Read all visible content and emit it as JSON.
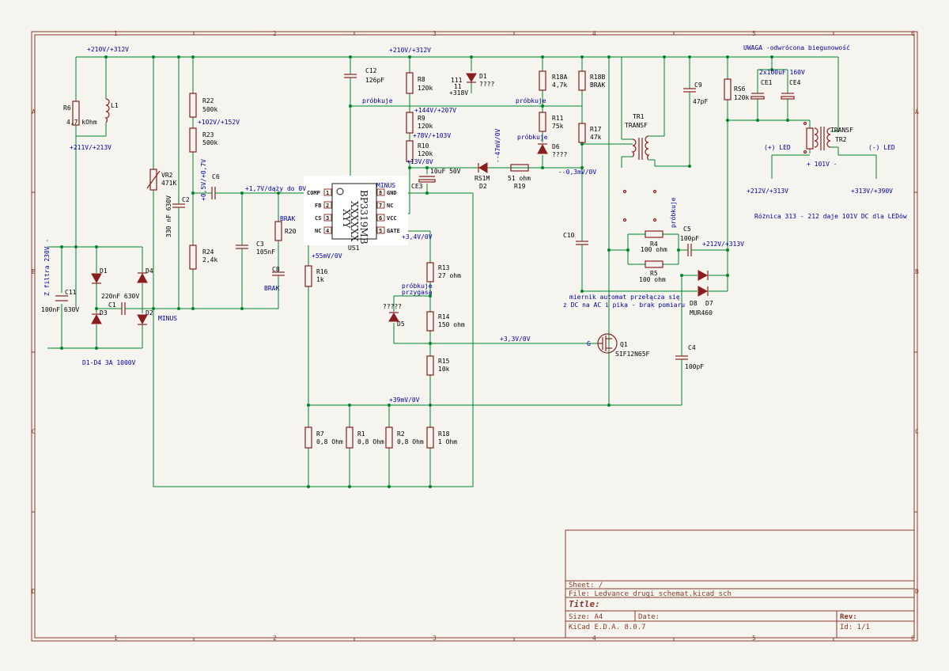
{
  "frame": {
    "cols": [
      "1",
      "2",
      "3",
      "4",
      "5",
      "6"
    ],
    "rows": [
      "A",
      "B",
      "C",
      "D"
    ]
  },
  "title_block": {
    "sheet": "Sheet: /",
    "file": "File: Ledvance drugi schemat.kicad_sch",
    "title": "Title:",
    "size": "Size: A4",
    "date": "Date:",
    "tool": "KiCad E.D.A. 8.0.7",
    "rev": "Rev:",
    "id": "Id: 1/1"
  },
  "ic": {
    "ref": "US1",
    "marking_1": "BP3319MB",
    "marking_2": "XXXXXX",
    "marking_3": "XYY",
    "minus": "MINUS",
    "pins_left": [
      "COMP",
      "FB",
      "CS",
      "NC"
    ],
    "pins_left_num": [
      "1",
      "2",
      "3",
      "4"
    ],
    "pins_right": [
      "GND",
      "NC",
      "VCC",
      "GATE"
    ],
    "pins_right_num": [
      "8",
      "7",
      "6",
      "5"
    ]
  },
  "components": {
    "R6": [
      "R6",
      "4,7 kOhm"
    ],
    "L1": [
      "L1"
    ],
    "R22": [
      "R22",
      "500k"
    ],
    "R23": [
      "R23",
      "500k"
    ],
    "R24": [
      "R24",
      "2,4k"
    ],
    "VR2": [
      "VR2",
      "471K"
    ],
    "C2": [
      "C2",
      "330 nF 630V"
    ],
    "C6": [
      "C6"
    ],
    "C3": [
      "C3",
      "105nF"
    ],
    "R20": [
      "R20"
    ],
    "C8": [
      "C8"
    ],
    "C11": [
      "C11",
      "100nF 630V"
    ],
    "C1": [
      "C1",
      "220nF 630V"
    ],
    "D1": [
      "D1"
    ],
    "D2": [
      "D2"
    ],
    "D3": [
      "D3"
    ],
    "D4": [
      "D4"
    ],
    "C12": [
      "C12",
      "126pF"
    ],
    "R8": [
      "R8",
      "120k"
    ],
    "R9": [
      "R9",
      "120k"
    ],
    "R10": [
      "R10",
      "120k"
    ],
    "CE3": [
      "CE3",
      "10uF 50V"
    ],
    "R16": [
      "R16",
      "1k"
    ],
    "R13": [
      "R13",
      "27 ohm"
    ],
    "R14": [
      "R14",
      "150 ohm"
    ],
    "R15": [
      "R15",
      "10k"
    ],
    "D5": [
      "D5",
      "?????"
    ],
    "R7": [
      "R7",
      "0,8 Ohm"
    ],
    "R1": [
      "R1",
      "0,8 Ohm"
    ],
    "R2": [
      "R2",
      "0,8 Ohm"
    ],
    "R18": [
      "R18",
      "1 Ohm"
    ],
    "D1b": [
      "D1",
      "????"
    ],
    "D1b_111": "111",
    "D1b_11": "11",
    "D1b_318": "+318V",
    "RS1M": [
      "RS1M",
      "D2"
    ],
    "R19": [
      "51 ohm",
      "R19"
    ],
    "R18A": [
      "R18A",
      "4,7k"
    ],
    "R18B": [
      "R18B",
      "BRAK"
    ],
    "R11": [
      "R11",
      "75k"
    ],
    "D6": [
      "D6",
      "????"
    ],
    "R17": [
      "R17",
      "47k"
    ],
    "TR1": [
      "TR1",
      "TRANSF"
    ],
    "C9": [
      "C9",
      "47pF"
    ],
    "C10": [
      "C10"
    ],
    "RS6": [
      "RS6",
      "120k"
    ],
    "CE1": [
      "CE1"
    ],
    "CE4": [
      "CE4"
    ],
    "TR2": [
      "TRANSF",
      "TR2"
    ],
    "R4": [
      "R4",
      "100 ohm"
    ],
    "R5": [
      "R5",
      "100 ohm"
    ],
    "C5": [
      "C5",
      "100pF"
    ],
    "D8": [
      "D8"
    ],
    "D7": [
      "D7"
    ],
    "MUR": "MUR460",
    "Q1": [
      "Q1",
      "SIF12N65F"
    ],
    "C4": [
      "C4",
      "100pF"
    ]
  },
  "labels": {
    "v210_left": "+210V/+312V",
    "v211": "+211V/+213V",
    "v102": "+102V/+152V",
    "v05": "+0,5V/+0,7V",
    "v17": "+1,7V/dąży do 0V",
    "brak_r20": "BRAK",
    "brak_c8": "BRAK",
    "v55": "+55mV/0V",
    "z_filtra": "Z filtra 230V -",
    "minus_left": "MINUS",
    "d1d4": "D1-D4 3A 1000V",
    "v210_top": "+210V/+312V",
    "probkuje1": "próbkuje",
    "probkuje2": "próbkuje",
    "probkuje3": "próbkuje",
    "probkuje4": "próbkuje",
    "probkuje_przygasa": "próbkuje\nprzygasa",
    "v144": "+144V/+207V",
    "v78": "+78V/+103V",
    "v13": "+13V/0V",
    "v34": "+3,4V/0V",
    "v47mv": "--47mV/0V",
    "v03mv": "--0,3mV/0V",
    "v33": "+3,3V/0V",
    "v39mv": "+39mV/0V",
    "uwaga": "UWAGA -odwrócona biegunowość",
    "ce_val": "2x100uF 160V",
    "plus_led": "(+) LED",
    "minus_led": "(-) LED",
    "v101": "+ 101V -",
    "v212": "+212V/+313V",
    "v313": "+313V/+390V",
    "roznica": "Różnica 313 - 212 daje 101V DC dla LEDów",
    "v212b": "+212V/+313V",
    "miernik1": "miernik automat przełącza się",
    "miernik2": "z DC na AC i pika - brak pomiaru",
    "gate_g": "G"
  }
}
